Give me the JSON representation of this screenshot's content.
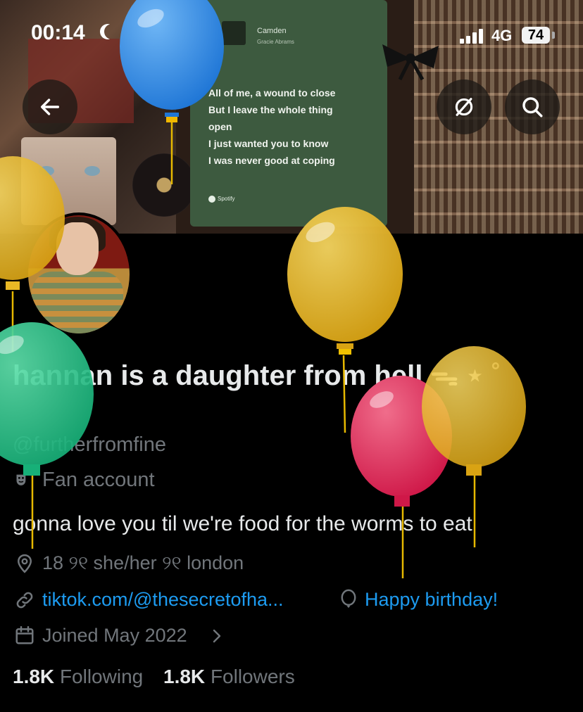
{
  "status_bar": {
    "time": "00:14",
    "network": "4G",
    "battery": "74"
  },
  "banner": {
    "song_title": "Camden",
    "song_artist": "Gracie Abrams",
    "lyrics": [
      "All of me, a wound to close",
      "But I leave the whole thing",
      "open",
      "I just wanted you to know",
      "I was never good at coping"
    ],
    "spotify_label": "Spotify"
  },
  "profile": {
    "display_name": "hannan is a daughter from hell ᯓ ⋆ ˚",
    "handle": "@furtherfromfine",
    "category": "Fan account",
    "bio": "gonna love you til we're food for the worms to eat",
    "location": "18 ୨୧ she/her ୨୧ london",
    "website": "tiktok.com/@thesecretofha...",
    "birthday": "Happy birthday!",
    "joined": "Joined May 2022",
    "following_count": "1.8K",
    "following_label": "Following",
    "followers_count": "1.8K",
    "followers_label": "Followers"
  },
  "icons": {
    "back": "arrow-left-icon",
    "follow_back": "sync-icon",
    "search": "search-icon",
    "location": "location-pin-icon",
    "link": "link-icon",
    "birthday": "balloon-icon",
    "calendar": "calendar-icon",
    "category": "theater-masks-icon"
  },
  "colors": {
    "accent": "#1d9bf0",
    "muted": "#71767b",
    "balloon_blue": "#2f8de4",
    "balloon_yellow": "#e9b825",
    "balloon_green": "#2bc98a",
    "balloon_red": "#e0315c"
  }
}
